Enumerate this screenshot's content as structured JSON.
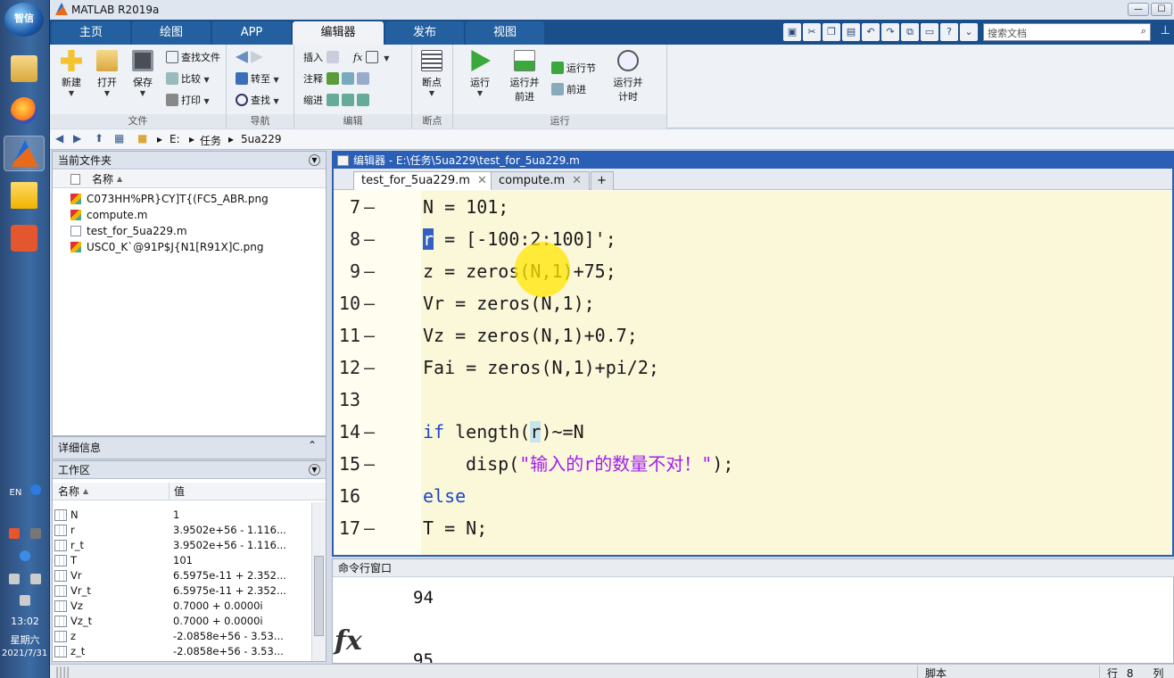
{
  "window": {
    "title": "MATLAB R2019a"
  },
  "ribbon_tabs": [
    "主页",
    "绘图",
    "APP",
    "编辑器",
    "发布",
    "视图"
  ],
  "search": {
    "placeholder": "搜索文档"
  },
  "ribbon": {
    "file": {
      "label": "文件",
      "new": "新建",
      "open": "打开",
      "save": "保存",
      "find_files": "查找文件",
      "compare": "比较",
      "print": "打印"
    },
    "navigate": {
      "label": "导航",
      "goto": "转至",
      "find": "查找"
    },
    "edit": {
      "label": "编辑",
      "insert": "插入",
      "fx": "fx",
      "comment": "注释",
      "indent": "缩进"
    },
    "breakpoints": {
      "label": "断点",
      "breakpoint": "断点"
    },
    "run": {
      "label": "运行",
      "run": "运行",
      "run_advance_1": "运行并",
      "run_advance_2": "前进",
      "run_section": "运行节",
      "advance": "前进",
      "run_time_1": "运行并",
      "run_time_2": "计时"
    }
  },
  "address": {
    "drive": "E:",
    "folder1": "任务",
    "folder2": "5ua229"
  },
  "file_panel": {
    "title": "当前文件夹",
    "col_name": "名称",
    "files": [
      {
        "name": "C073HH%PR}CY]T{(FC5_ABR.png",
        "type": "png"
      },
      {
        "name": "compute.m",
        "type": "m"
      },
      {
        "name": "test_for_5ua229.m",
        "type": "m"
      },
      {
        "name": "USC0_K`@91P$J{N1[R91X]C.png",
        "type": "png"
      }
    ]
  },
  "detail_panel": {
    "title": "详细信息"
  },
  "workspace": {
    "title": "工作区",
    "col_name": "名称",
    "col_value": "值",
    "vars": [
      {
        "name": "N",
        "value": "1"
      },
      {
        "name": "r",
        "value": "3.9502e+56 - 1.116..."
      },
      {
        "name": "r_t",
        "value": "3.9502e+56 - 1.116..."
      },
      {
        "name": "T",
        "value": "101"
      },
      {
        "name": "Vr",
        "value": "6.5975e-11 + 2.352..."
      },
      {
        "name": "Vr_t",
        "value": "6.5975e-11 + 2.352..."
      },
      {
        "name": "Vz",
        "value": "0.7000 + 0.0000i"
      },
      {
        "name": "Vz_t",
        "value": "0.7000 + 0.0000i"
      },
      {
        "name": "z",
        "value": "-2.0858e+56 - 3.53..."
      },
      {
        "name": "z_t",
        "value": "-2.0858e+56 - 3.53..."
      }
    ]
  },
  "editor": {
    "title": "编辑器 - E:\\任务\\5ua229\\test_for_5ua229.m",
    "tabs": [
      "test_for_5ua229.m",
      "compute.m"
    ],
    "add_tab": "+",
    "lines": {
      "l7": {
        "num": "7",
        "pre": "N = 101;"
      },
      "l8": {
        "num": "8",
        "sel": "r",
        "post": " = [-100:2:100]';"
      },
      "l9": {
        "num": "9",
        "pre": "z = zeros(N,1)+75;"
      },
      "l10": {
        "num": "10",
        "pre": "Vr = zeros(N,1);"
      },
      "l11": {
        "num": "11",
        "pre": "Vz = zeros(N,1)+0.7;"
      },
      "l12": {
        "num": "12",
        "pre": "Fai = zeros(N,1)+pi/2;"
      },
      "l13": {
        "num": "13"
      },
      "l14": {
        "num": "14",
        "kw": "if",
        "pre": " length(",
        "var": "r",
        "post": ")~=N"
      },
      "l15": {
        "num": "15",
        "pre": "disp(",
        "str": "\"输入的r的数量不对！\"",
        "post": ");"
      },
      "l16": {
        "num": "16",
        "kw": "else"
      },
      "l17": {
        "num": "17",
        "pre": "T = N;"
      }
    }
  },
  "command_window": {
    "title": "命令行窗口",
    "out1": "94",
    "out2": "95",
    "fx": "fx"
  },
  "status": {
    "mode": "脚本",
    "row_label": "行",
    "row": "8",
    "col_label": "列"
  },
  "taskbar": {
    "orb_text": "智信",
    "lang": "EN",
    "time": "13:02",
    "weekday": "星期六",
    "date": "2021/7/31"
  }
}
